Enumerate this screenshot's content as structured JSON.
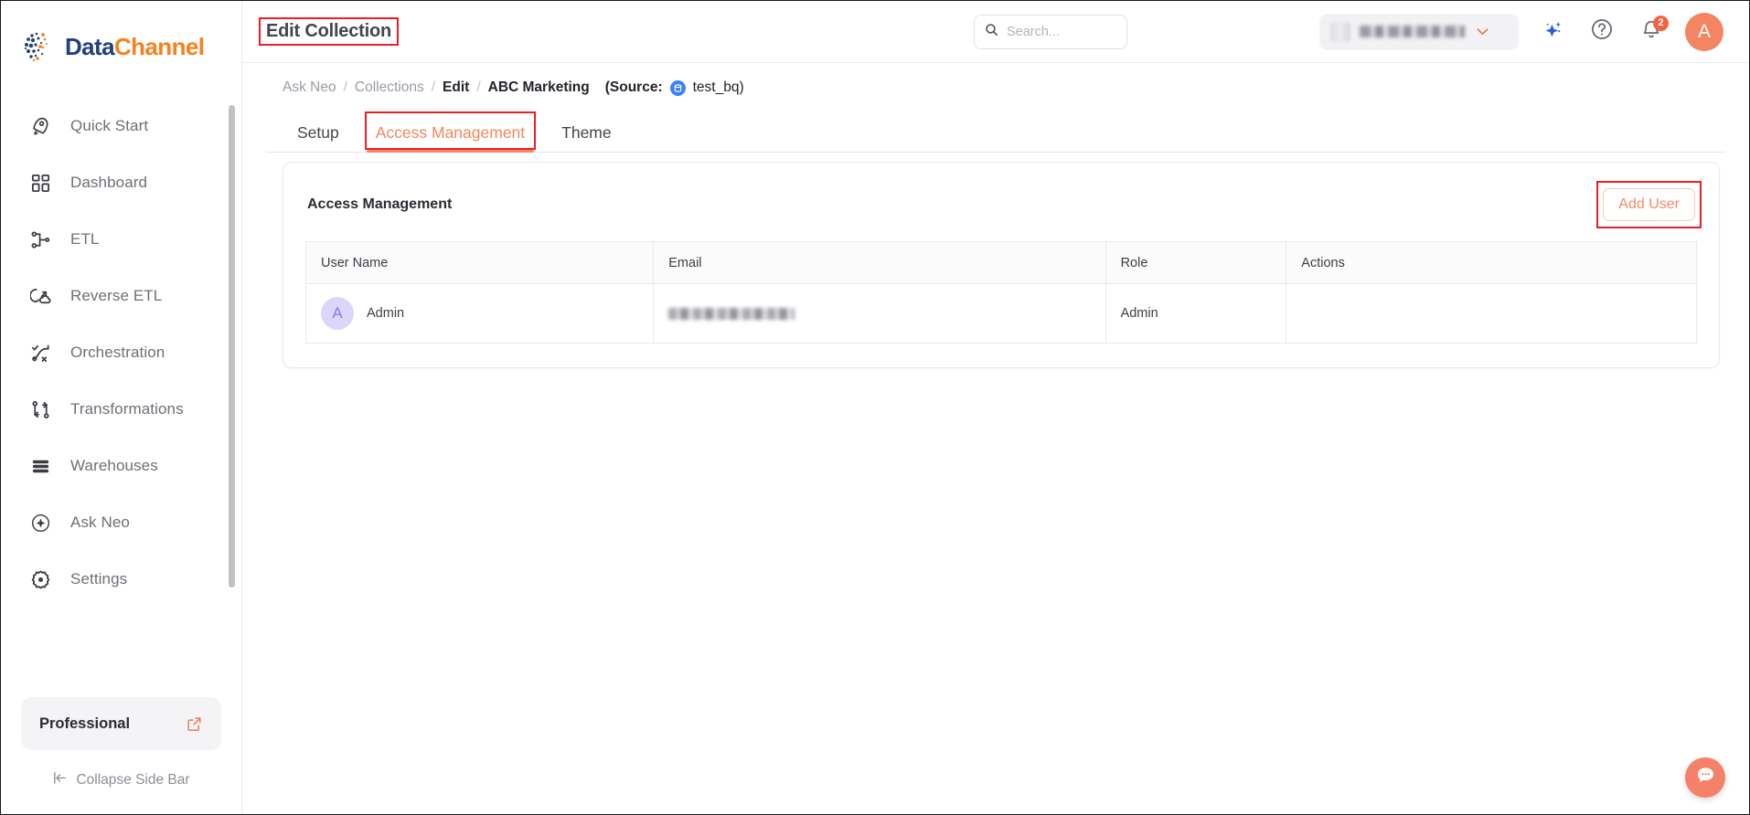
{
  "brand": {
    "name_part1": "Data",
    "name_part2": "Channel",
    "color_primary": "#23407a",
    "color_accent": "#f58220"
  },
  "sidebar": {
    "items": [
      {
        "label": "Quick Start",
        "icon": "rocket-icon"
      },
      {
        "label": "Dashboard",
        "icon": "grid-icon"
      },
      {
        "label": "ETL",
        "icon": "etl-icon"
      },
      {
        "label": "Reverse ETL",
        "icon": "reverse-etl-icon"
      },
      {
        "label": "Orchestration",
        "icon": "orchestration-icon"
      },
      {
        "label": "Transformations",
        "icon": "transformations-icon"
      },
      {
        "label": "Warehouses",
        "icon": "warehouse-icon"
      },
      {
        "label": "Ask Neo",
        "icon": "sparkle-circle-icon"
      },
      {
        "label": "Settings",
        "icon": "gear-icon"
      }
    ],
    "plan": {
      "label": "Professional",
      "icon": "external-link-icon"
    },
    "collapse": {
      "label": "Collapse Side Bar",
      "icon": "collapse-left-icon"
    }
  },
  "topbar": {
    "page_title": "Edit Collection",
    "search": {
      "value": "",
      "placeholder": "Search..."
    },
    "org_selector": {
      "value": "",
      "caret_icon": "chevron-down-icon"
    },
    "ai_icon": "sparkle-icon",
    "help_icon": "question-circle-icon",
    "notifications": {
      "icon": "bell-icon",
      "count": "2"
    },
    "avatar": {
      "initial": "A",
      "color": "#f58562"
    }
  },
  "breadcrumb": {
    "items": [
      {
        "label": "Ask Neo",
        "strong": false
      },
      {
        "label": "Collections",
        "strong": false
      },
      {
        "label": "Edit",
        "strong": true
      },
      {
        "label": "ABC Marketing",
        "strong": true
      }
    ],
    "separator": "/",
    "source_label": "(Source:",
    "source_name": "test_bq)",
    "source_icon": "database-dot-icon"
  },
  "tabs": [
    {
      "label": "Setup",
      "active": false,
      "annotated": false
    },
    {
      "label": "Access Management",
      "active": true,
      "annotated": true
    },
    {
      "label": "Theme",
      "active": false,
      "annotated": false
    }
  ],
  "panel": {
    "title": "Access Management",
    "add_user_label": "Add User",
    "table": {
      "columns": [
        "User Name",
        "Email",
        "Role",
        "Actions"
      ],
      "rows": [
        {
          "avatar_initial": "A",
          "user_name": "Admin",
          "email": "",
          "email_redacted": true,
          "role": "Admin",
          "actions": ""
        }
      ]
    }
  },
  "chat_widget": {
    "icon": "chat-bubble-icon",
    "color": "#f6816a"
  },
  "annotations": {
    "color": "#ee1c25"
  }
}
